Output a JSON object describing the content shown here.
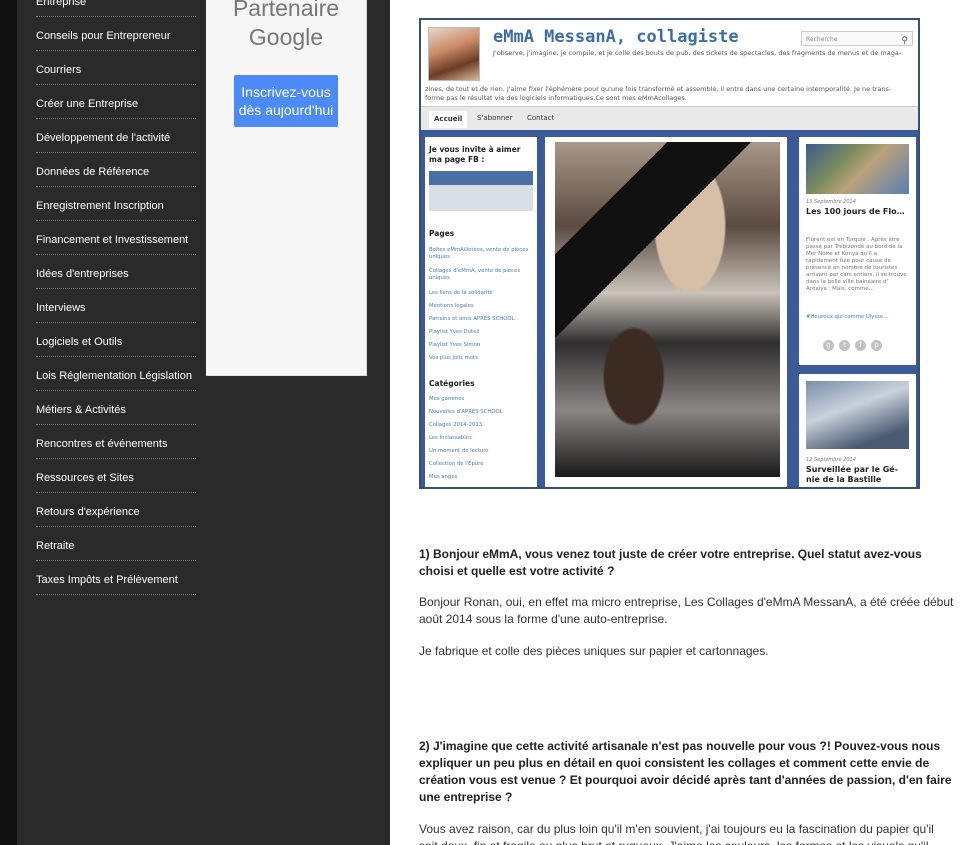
{
  "sidebar": {
    "categories": [
      "Entreprise",
      "Conseils pour Entrepreneur",
      "Courriers",
      "Créer une Entreprise",
      "Développement de l'activité",
      "Données de Référence",
      "Enregistrement Inscription",
      "Financement et Investissement",
      "Idées d'entreprises",
      "Interviews",
      "Logiciels et Outils",
      "Lois Réglementation Législation",
      "Métiers & Activités",
      "Rencontres et événements",
      "Ressources et Sites",
      "Retours d'expérience",
      "Retraite",
      "Taxes Impôts et Prélèvement"
    ]
  },
  "ad": {
    "title": "Partenaire Google",
    "button": "Inscrivez-vous dès aujourd'hui",
    "button_color": "#4c8bf5"
  },
  "blog": {
    "title": "eMmA MessanA, collagiste",
    "tagline_1": "J'observe, j'imagine, je compile, et je colle des bouts de pub, des tickets de spectacles, des fragments de menus et de maga-",
    "tagline_2": "zines, de tout et de rien. J'aime fixer l'éphémère pour qu'une fois transformé et assemblé, il entre dans une certaine intemporalité. Je ne trans- forme pas le résultat via des logiciels informatiques.Ce sont mes eMmAcollages.",
    "search_placeholder": "Recherche",
    "search_icon": "magnifier-icon",
    "nav": [
      "Accueil",
      "S'abonner",
      "Contact"
    ],
    "fb_invite": "Je vous invite à aimer ma page FB :",
    "pages_heading": "Pages",
    "pages": [
      "Boîtes eMmAillotées, vente de pièces uniques",
      "Collages d'eMmA, vente de pièces uniques",
      "Les liens de la solidarité",
      "Mentions légales",
      "Parrains et amis APRES SCHOOL",
      "Playlist Yves Duteil",
      "Playlist Yves Simon",
      "Vos plus jolis mots"
    ],
    "categories_heading": "Catégories",
    "categories": [
      "Mes gammes",
      "Nouvelles d'APRES SCHOOL",
      "Collages 2014-2013",
      "Les Inclassables",
      "Un moment de lecture",
      "Collection de l'Epure",
      "Mes anges"
    ],
    "post1": {
      "date": "13 Septembre 2014",
      "title": "Les 100 jours de Flo…",
      "text": "Florent est en Turquie . Après être passé par Trébizonde au bord de la Mer Noire et Konya qu'il a rapidement fuie pour cause de présence en nombre de touristes arrivant par cars entiers, il se trouve dans la belle ville balnéaire d' Antalya . Mais, comme…",
      "link": "#Heureux qui comme Ulysse…"
    },
    "post2": {
      "date": "12 Septembre 2014",
      "title": "Surveillée par le Gé- nie de la Bastille"
    },
    "share_icons": [
      "google-plus-icon",
      "twitter-icon",
      "facebook-icon",
      "pinterest-icon"
    ]
  },
  "article": {
    "q1": "1) Bonjour eMmA, vous venez tout juste de créer votre entreprise. Quel statut avez-vous choisi et quelle est votre activité ?",
    "a1_p1": "Bonjour Ronan, oui, en effet ma micro entreprise, Les Collages d'eMmA MessanA, a été créée début août 2014 sous la forme d'une auto-entreprise.",
    "a1_p2": "Je fabrique et colle des pièces uniques sur papier et cartonnages.",
    "q2": "2) J'imagine que cette activité artisanale n'est pas nouvelle pour vous ?! Pouvez-vous nous expliquer un peu plus en détail en quoi consistent les collages et comment cette envie de création vous est venue ? Et pourquoi avoir décidé après tant d'années de passion, d'en faire une entreprise ?",
    "a2_p1": "Vous avez raison, car du plus loin qu'il m'en souvient, j'ai toujours eu la fascination du papier qu'il soit doux, fin et fragile ou plus brut et rugueux. J'aime les couleurs, les formes et les visuels qu'il"
  }
}
